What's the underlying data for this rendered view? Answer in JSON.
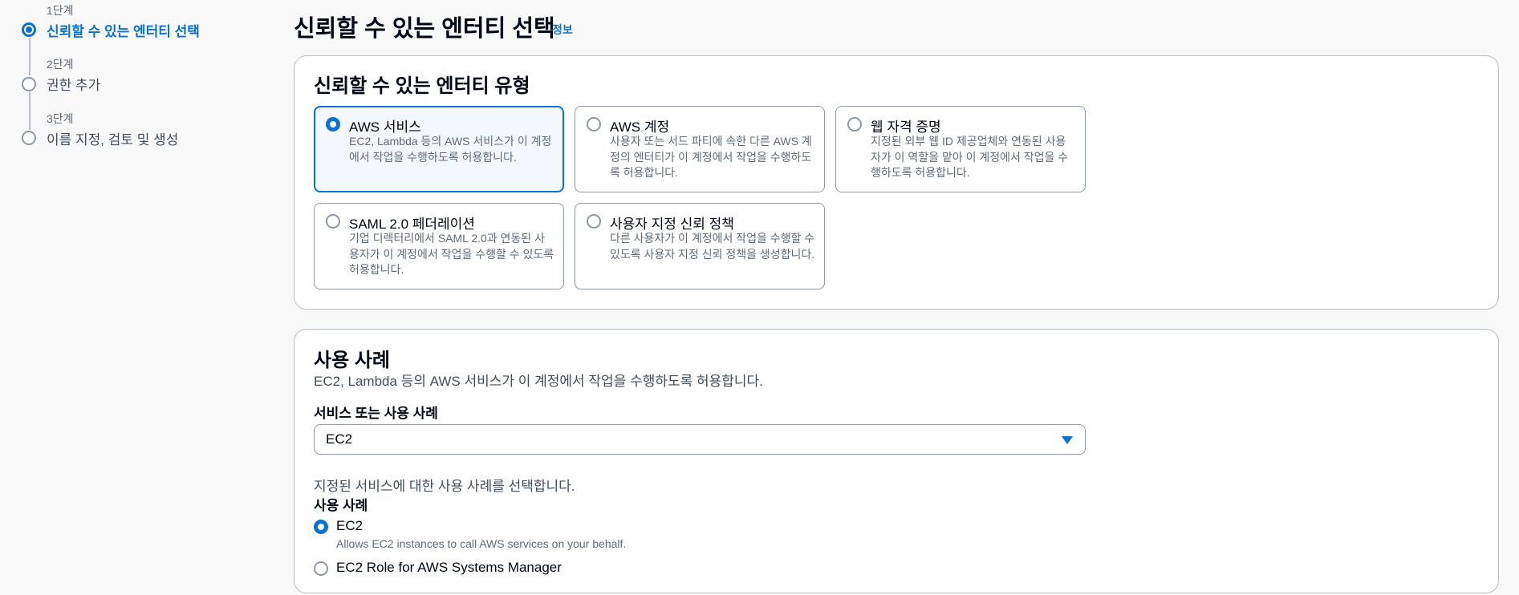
{
  "steps": [
    {
      "number": "1단계",
      "label": "신뢰할 수 있는 엔터티 선택",
      "active": true
    },
    {
      "number": "2단계",
      "label": "권한 추가",
      "active": false
    },
    {
      "number": "3단계",
      "label": "이름 지정, 검토 및 생성",
      "active": false
    }
  ],
  "page": {
    "title": "신뢰할 수 있는 엔터티 선택",
    "info_link": "정보"
  },
  "entity_type": {
    "heading": "신뢰할 수 있는 엔터티 유형",
    "options": [
      {
        "title": "AWS 서비스",
        "description": "EC2, Lambda 등의 AWS 서비스가 이 계정에서 작업을 수행하도록 허용합니다.",
        "selected": true
      },
      {
        "title": "AWS 계정",
        "description": "사용자 또는 서드 파티에 속한 다른 AWS 계정의 엔터티가 이 계정에서 작업을 수행하도록 허용합니다.",
        "selected": false
      },
      {
        "title": "웹 자격 증명",
        "description": "지정된 외부 웹 ID 제공업체와 연동된 사용자가 이 역할을 맡아 이 계정에서 작업을 수행하도록 허용합니다.",
        "selected": false
      },
      {
        "title": "SAML 2.0 페더레이션",
        "description": "기업 디렉터리에서 SAML 2.0과 연동된 사용자가 이 계정에서 작업을 수행할 수 있도록 허용합니다.",
        "selected": false
      },
      {
        "title": "사용자 지정 신뢰 정책",
        "description": "다른 사용자가 이 계정에서 작업을 수행할 수 있도록 사용자 지정 신뢰 정책을 생성합니다.",
        "selected": false
      }
    ]
  },
  "use_case": {
    "heading": "사용 사례",
    "description": "EC2, Lambda 등의 AWS 서비스가 이 계정에서 작업을 수행하도록 허용합니다.",
    "service_label": "서비스 또는 사용 사례",
    "service_value": "EC2",
    "hint": "지정된 서비스에 대한 사용 사례를 선택합니다.",
    "use_case_label": "사용 사례",
    "options": [
      {
        "title": "EC2",
        "description": "Allows EC2 instances to call AWS services on your behalf.",
        "selected": true
      },
      {
        "title": "EC2 Role for AWS Systems Manager",
        "description": "",
        "selected": false
      }
    ]
  },
  "colors": {
    "accent": "#0972d3",
    "selected_tile_bg": "#f2f8fd",
    "border": "#8d99a8"
  }
}
